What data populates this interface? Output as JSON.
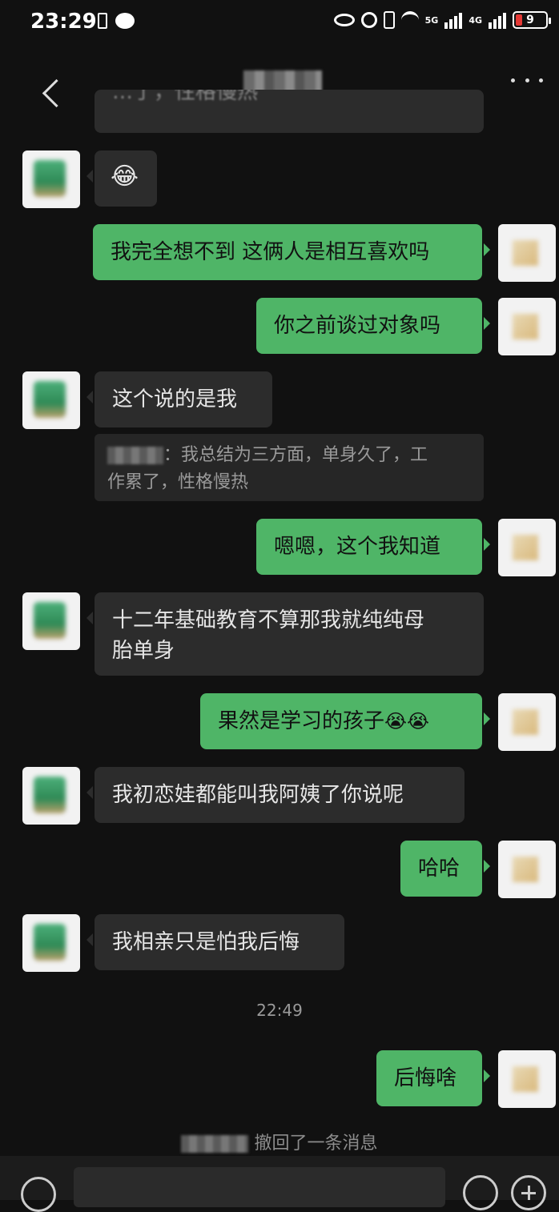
{
  "status_bar": {
    "time": "23:29",
    "battery": "9",
    "net_5g": "5G",
    "net_4g": "4G"
  },
  "chat": {
    "top_partial_text": "…了，性格慢热",
    "messages": [
      {
        "side": "in",
        "text": "😂"
      },
      {
        "side": "out",
        "text": "我完全想不到 这俩人是相互喜欢吗"
      },
      {
        "side": "out",
        "text": "你之前谈过对象吗"
      },
      {
        "side": "in",
        "text": "这个说的是我"
      },
      {
        "side": "out",
        "text": "嗯嗯，这个我知道"
      },
      {
        "side": "in",
        "text_line1": "十二年基础教育不算那我就纯纯母",
        "text_line2": "胎单身"
      },
      {
        "side": "out",
        "text": "果然是学习的孩子",
        "emoji": "😭😭"
      },
      {
        "side": "in",
        "text": "我初恋娃都能叫我阿姨了你说呢"
      },
      {
        "side": "out",
        "text": "哈哈"
      },
      {
        "side": "in",
        "text": "我相亲只是怕我后悔"
      },
      {
        "side": "out",
        "text": "后悔啥"
      }
    ],
    "quote": {
      "line1": "：我总结为三方面，单身久了，工",
      "line2": "作累了，性格慢热"
    },
    "time_separator": "22:49",
    "recall_notice": "撤回了一条消息"
  },
  "colors": {
    "outgoing_bubble": "#4fb567",
    "incoming_bubble": "#2c2c2c",
    "background": "#111111"
  }
}
